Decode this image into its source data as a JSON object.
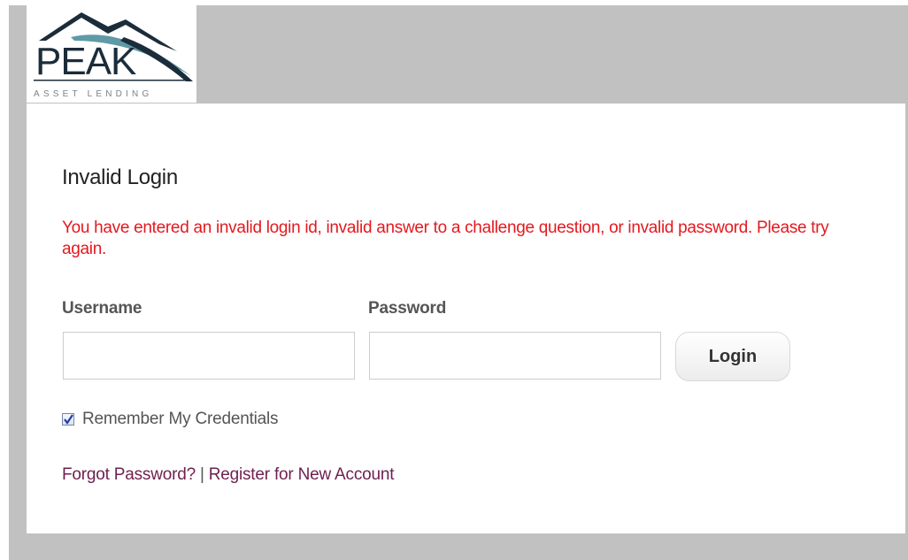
{
  "logo": {
    "word": "PEAK",
    "tagline": "ASSET LENDING"
  },
  "login": {
    "title": "Invalid Login",
    "error_message": "You have entered an invalid login id, invalid answer to a challenge question, or invalid password. Please try again.",
    "username_label": "Username",
    "password_label": "Password",
    "username_value": "",
    "password_value": "",
    "login_button": "Login",
    "remember_label": "Remember My Credentials",
    "remember_checked": true,
    "forgot_link": "Forgot Password?",
    "separator": "|",
    "register_link": "Register for New Account"
  },
  "colors": {
    "page_background": "#c1c1c1",
    "panel_background": "#ffffff",
    "error_text": "#e4191f",
    "link_text": "#6e1f4e",
    "logo_dark": "#1b2c3a",
    "logo_teal": "#5f9aa6"
  },
  "icons": {
    "logo_mark": "mountain-peaks-icon",
    "remember_checkbox": "checkmark-icon"
  }
}
